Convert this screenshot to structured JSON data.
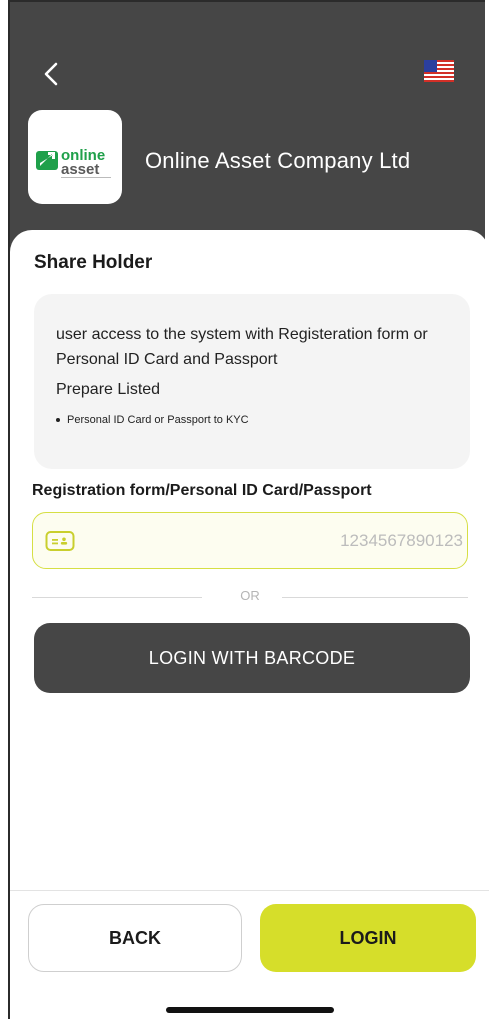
{
  "header": {
    "company_name": "Online Asset Company Ltd",
    "back_icon": "chevron-left-icon",
    "language_icon": "us-flag-icon",
    "logo": {
      "word1": "online",
      "word2": "asset",
      "brand_green": "#1fa04a"
    }
  },
  "main": {
    "section_title": "Share Holder",
    "info": {
      "description": "user access to the system with Registeration form or Personal ID Card and Passport",
      "prepare_title": "Prepare Listed",
      "items": [
        "Personal ID Card or Passport to KYC"
      ]
    },
    "field": {
      "label": "Registration form/Personal ID Card/Passport",
      "placeholder": "1234567890123",
      "value": "",
      "icon": "id-card-icon"
    },
    "divider_text": "OR",
    "barcode_button": "LOGIN WITH BARCODE"
  },
  "footer": {
    "back_label": "BACK",
    "login_label": "LOGIN"
  },
  "colors": {
    "header_bg": "#464646",
    "accent": "#d6de2a",
    "field_border": "#d6df44"
  }
}
